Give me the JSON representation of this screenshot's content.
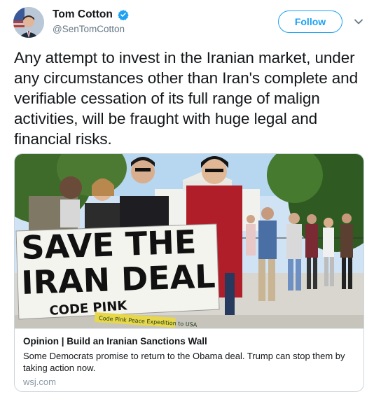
{
  "author": {
    "display_name": "Tom Cotton",
    "handle": "@SenTomCotton"
  },
  "follow_label": "Follow",
  "tweet_text": "Any attempt to invest in the Iranian market, under any circumstances other than Iran's complete and verifiable cessation of its full range of malign activities, will be fraught with huge legal and financial risks.",
  "card": {
    "image": {
      "banner_line1": "SAVE THE",
      "banner_line2": "IRAN DEAL",
      "banner_sign": "CODE PINK",
      "small_sign": "Code Pink Peace Expedition to USA"
    },
    "title": "Opinion | Build an Iranian Sanctions Wall",
    "description": "Some Democrats promise to return to the Obama deal. Trump can stop them by taking action now.",
    "domain": "wsj.com"
  },
  "colors": {
    "accent": "#1da1f2",
    "text": "#14171a",
    "secondary": "#657786",
    "border": "#ccd6dd"
  },
  "icons": {
    "verified": "verified-badge-icon",
    "more": "chevron-down-icon"
  }
}
